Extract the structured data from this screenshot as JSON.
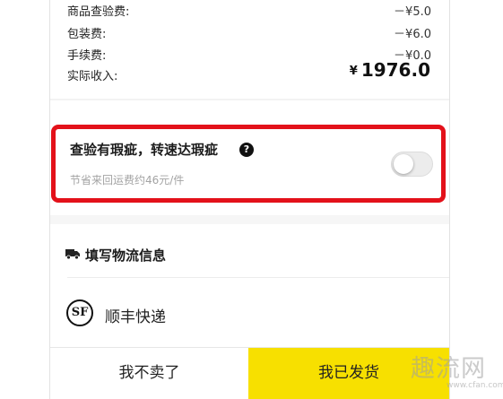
{
  "fees": [
    {
      "label": "商品查验费:",
      "amount": "－¥5.0"
    },
    {
      "label": "包装费:",
      "amount": "－¥6.0"
    },
    {
      "label": "手续费:",
      "amount": "－¥0.0"
    }
  ],
  "income": {
    "label": "实际收入:",
    "currency": "¥",
    "amount": "1976.0"
  },
  "defect_option": {
    "title": "查验有瑕疵，转速达瑕疵",
    "help_icon": "?",
    "subtitle": "节省来回运费约46元/件",
    "toggle_on": false
  },
  "logistics": {
    "title": "填写物流信息",
    "icon": "truck-icon"
  },
  "courier": {
    "logo_text": "SF",
    "name": "顺丰快递"
  },
  "actions": {
    "decline_label": "我不卖了",
    "shipped_label": "我已发货"
  },
  "colors": {
    "accent": "#f7e000",
    "highlight": "#e3111a"
  },
  "watermark": {
    "text": "趣流网",
    "url": "www.cfan.com"
  }
}
